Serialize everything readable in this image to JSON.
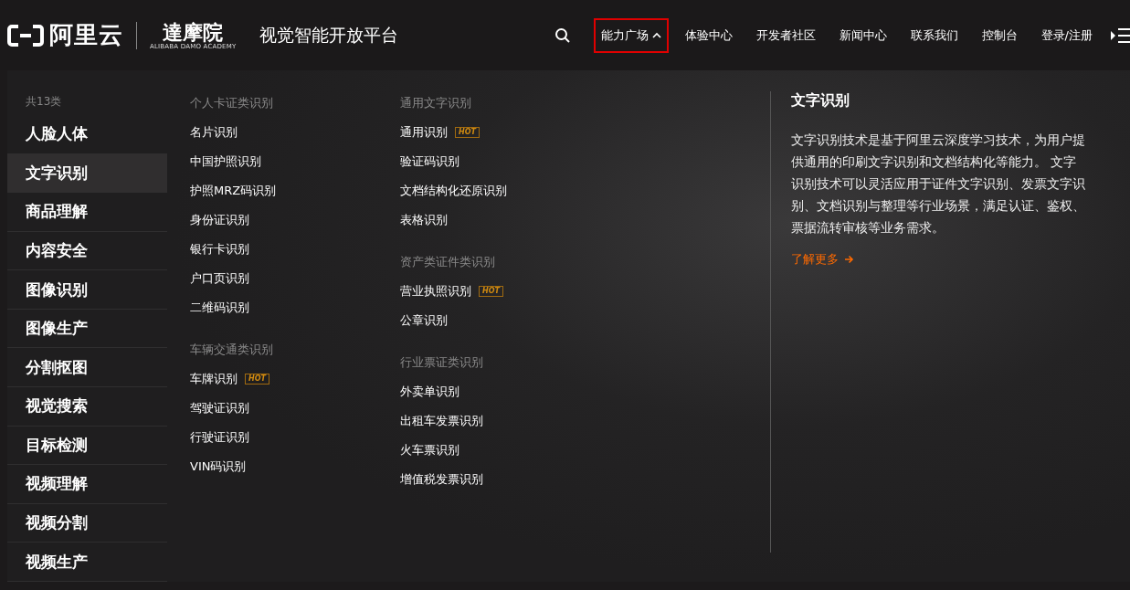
{
  "header": {
    "brand": "阿里云",
    "academy": "達摩院",
    "academy_subtitle": "ALIBABA DAMO ACADEMY",
    "platform_title": "视觉智能开放平台",
    "nav": [
      {
        "label": "能力广场",
        "selected": true,
        "expanded": true
      },
      {
        "label": "体验中心",
        "selected": false,
        "expanded": false
      },
      {
        "label": "开发者社区",
        "selected": false,
        "expanded": false
      },
      {
        "label": "新闻中心",
        "selected": false,
        "expanded": false
      },
      {
        "label": "联系我们",
        "selected": false,
        "expanded": false
      },
      {
        "label": "控制台",
        "selected": false,
        "expanded": false
      },
      {
        "label": "登录/注册",
        "selected": false,
        "expanded": false
      }
    ]
  },
  "menu": {
    "count": "共13类",
    "categories": [
      {
        "label": "人脸人体",
        "selected": false
      },
      {
        "label": "文字识别",
        "selected": true
      },
      {
        "label": "商品理解",
        "selected": false
      },
      {
        "label": "内容安全",
        "selected": false
      },
      {
        "label": "图像识别",
        "selected": false
      },
      {
        "label": "图像生产",
        "selected": false
      },
      {
        "label": "分割抠图",
        "selected": false
      },
      {
        "label": "视觉搜索",
        "selected": false
      },
      {
        "label": "目标检测",
        "selected": false
      },
      {
        "label": "视频理解",
        "selected": false
      },
      {
        "label": "视频分割",
        "selected": false
      },
      {
        "label": "视频生产",
        "selected": false
      }
    ],
    "columns": [
      [
        {
          "title": "个人卡证类识别",
          "items": [
            {
              "label": "名片识别",
              "hot": false
            },
            {
              "label": "中国护照识别",
              "hot": false
            },
            {
              "label": "护照MRZ码识别",
              "hot": false
            },
            {
              "label": "身份证识别",
              "hot": false
            },
            {
              "label": "银行卡识别",
              "hot": false
            },
            {
              "label": "户口页识别",
              "hot": false
            },
            {
              "label": "二维码识别",
              "hot": false
            }
          ]
        },
        {
          "title": "车辆交通类识别",
          "items": [
            {
              "label": "车牌识别",
              "hot": true,
              "badge": "HOT"
            },
            {
              "label": "驾驶证识别",
              "hot": false
            },
            {
              "label": "行驶证识别",
              "hot": false
            },
            {
              "label": "VIN码识别",
              "hot": false
            }
          ]
        }
      ],
      [
        {
          "title": "通用文字识别",
          "items": [
            {
              "label": "通用识别",
              "hot": true,
              "badge": "HOT"
            },
            {
              "label": "验证码识别",
              "hot": false
            },
            {
              "label": "文档结构化还原识别",
              "hot": false
            },
            {
              "label": "表格识别",
              "hot": false
            }
          ]
        },
        {
          "title": "资产类证件类识别",
          "items": [
            {
              "label": "营业执照识别",
              "hot": true,
              "badge": "HOT"
            },
            {
              "label": "公章识别",
              "hot": false
            }
          ]
        },
        {
          "title": "行业票证类识别",
          "items": [
            {
              "label": "外卖单识别",
              "hot": false
            },
            {
              "label": "出租车发票识别",
              "hot": false
            },
            {
              "label": "火车票识别",
              "hot": false
            },
            {
              "label": "增值税发票识别",
              "hot": false
            }
          ]
        }
      ]
    ],
    "detail": {
      "title": "文字识别",
      "description": "文字识别技术是基于阿里云深度学习技术，为用户提供通用的印刷文字识别和文档结构化等能力。 文字识别技术可以灵活应用于证件文字识别、发票文字识别、文档识别与整理等行业场景，满足认证、鉴权、票据流转审核等业务需求。",
      "link": "了解更多"
    }
  }
}
